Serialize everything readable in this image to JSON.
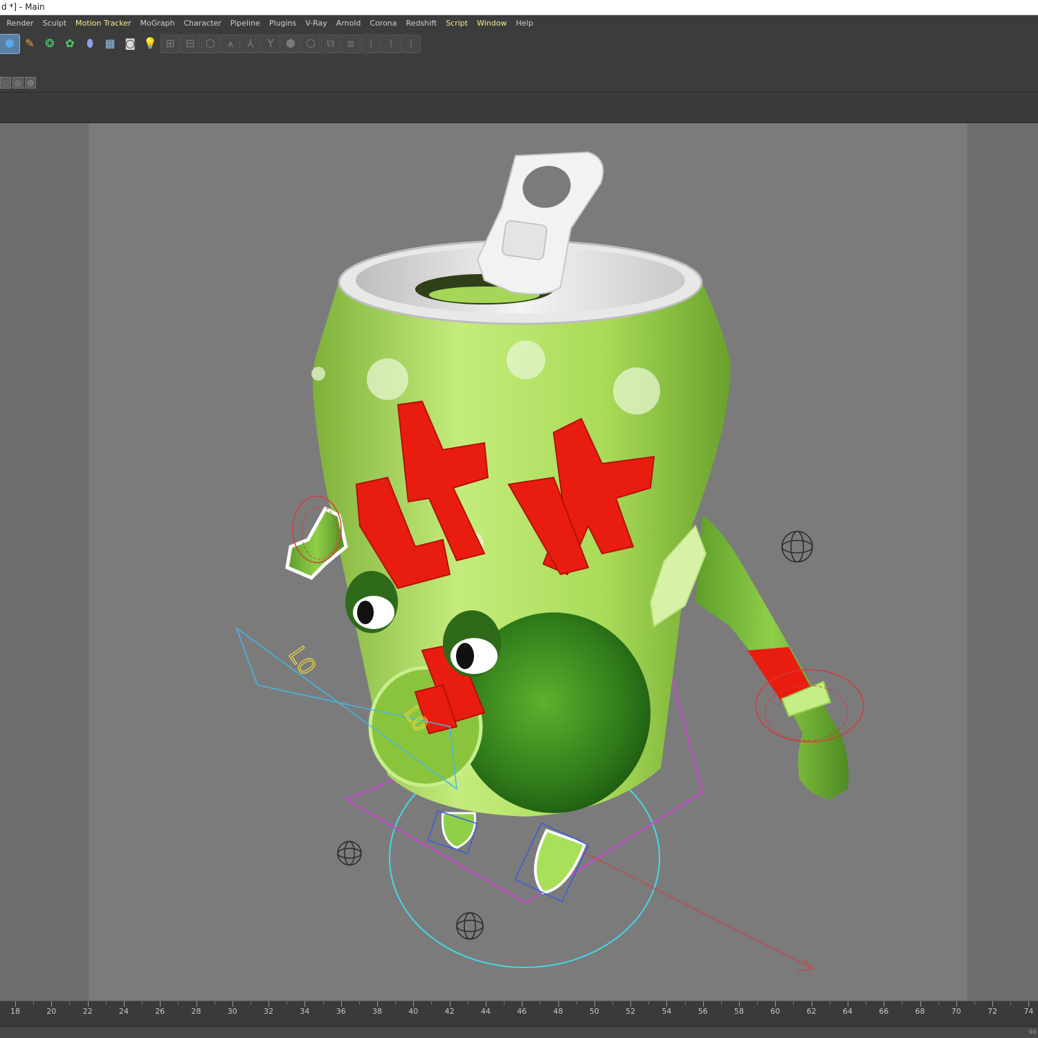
{
  "window": {
    "title": "d *] - Main"
  },
  "menu": [
    {
      "label": "Render",
      "hl": false
    },
    {
      "label": "Sculpt",
      "hl": false
    },
    {
      "label": "Motion Tracker",
      "hl": true
    },
    {
      "label": "MoGraph",
      "hl": false
    },
    {
      "label": "Character",
      "hl": false
    },
    {
      "label": "Pipeline",
      "hl": false
    },
    {
      "label": "Plugins",
      "hl": false
    },
    {
      "label": "V-Ray",
      "hl": false
    },
    {
      "label": "Arnold",
      "hl": false
    },
    {
      "label": "Corona",
      "hl": false
    },
    {
      "label": "Redshift",
      "hl": false
    },
    {
      "label": "Script",
      "hl": true
    },
    {
      "label": "Window",
      "hl": true
    },
    {
      "label": "Help",
      "hl": false
    }
  ],
  "toolbar": {
    "icons": [
      {
        "name": "cube-icon",
        "glyph": "⬢",
        "color": "#5fa6e6",
        "active": true
      },
      {
        "name": "pen-icon",
        "glyph": "✎",
        "color": "#e9a43a"
      },
      {
        "name": "subdivision-icon",
        "glyph": "❂",
        "color": "#4fd06b"
      },
      {
        "name": "cloner-icon",
        "glyph": "✿",
        "color": "#4fd06b"
      },
      {
        "name": "deformer-icon",
        "glyph": "⬮",
        "color": "#8aa0e6"
      },
      {
        "name": "floor-icon",
        "glyph": "▦",
        "color": "#8ec0ec"
      },
      {
        "name": "camera-icon",
        "glyph": "◙",
        "color": "#d8d8d8"
      },
      {
        "name": "light-icon",
        "glyph": "💡",
        "color": "#e8e8e8"
      },
      {
        "name": "joint-tool-icon",
        "glyph": "⊞",
        "color": "#7a7a7a",
        "dim": true
      },
      {
        "name": "ik-chain-icon",
        "glyph": "⊟",
        "color": "#7a7a7a",
        "dim": true
      },
      {
        "name": "skin-icon",
        "glyph": "⬡",
        "color": "#7a7a7a",
        "dim": true
      },
      {
        "name": "weight-tool-icon",
        "glyph": "⩚",
        "color": "#7a7a7a",
        "dim": true
      },
      {
        "name": "bone-icon",
        "glyph": "⅄",
        "color": "#7a7a7a",
        "dim": true
      },
      {
        "name": "branch-icon",
        "glyph": "Y",
        "color": "#7a7a7a",
        "dim": true
      },
      {
        "name": "morph-icon",
        "glyph": "⬢",
        "color": "#7a7a7a",
        "dim": true
      },
      {
        "name": "cmotion-icon",
        "glyph": "⬡",
        "color": "#7a7a7a",
        "dim": true
      },
      {
        "name": "mirror-icon",
        "glyph": "⧉",
        "color": "#7a7a7a",
        "dim": true
      },
      {
        "name": "align-icon",
        "glyph": "⧈",
        "color": "#7a7a7a",
        "dim": true
      },
      {
        "name": "grid-a-icon",
        "glyph": "⁞",
        "color": "#7a7a7a",
        "dim": true
      },
      {
        "name": "grid-b-icon",
        "glyph": "⁞",
        "color": "#7a7a7a",
        "dim": true
      },
      {
        "name": "grid-c-icon",
        "glyph": "⁞",
        "color": "#7a7a7a",
        "dim": true
      }
    ],
    "sub_icons": [
      {
        "name": "mode-a-icon",
        "glyph": "◌"
      },
      {
        "name": "mode-b-icon",
        "glyph": "◎"
      },
      {
        "name": "mode-c-icon",
        "glyph": "◍"
      }
    ]
  },
  "viewport": {
    "rig_labels": [
      "L0",
      "L0"
    ],
    "colors": {
      "can_green": "#9fd24a",
      "logo_red": "#e81d10",
      "rig_cyan": "#44d8e6",
      "rig_magenta": "#d043d6",
      "rig_red": "#d63a3a",
      "rig_blue": "#3a5adf",
      "rig_yellow": "#e6d840"
    }
  },
  "timeline": {
    "labels": [
      "18",
      "20",
      "22",
      "24",
      "26",
      "28",
      "30",
      "32",
      "34",
      "36",
      "38",
      "40",
      "42",
      "44",
      "46",
      "48",
      "50",
      "52",
      "54",
      "56",
      "58",
      "60",
      "62",
      "64",
      "66",
      "68",
      "70",
      "72",
      "74"
    ],
    "end_frame": "90"
  }
}
